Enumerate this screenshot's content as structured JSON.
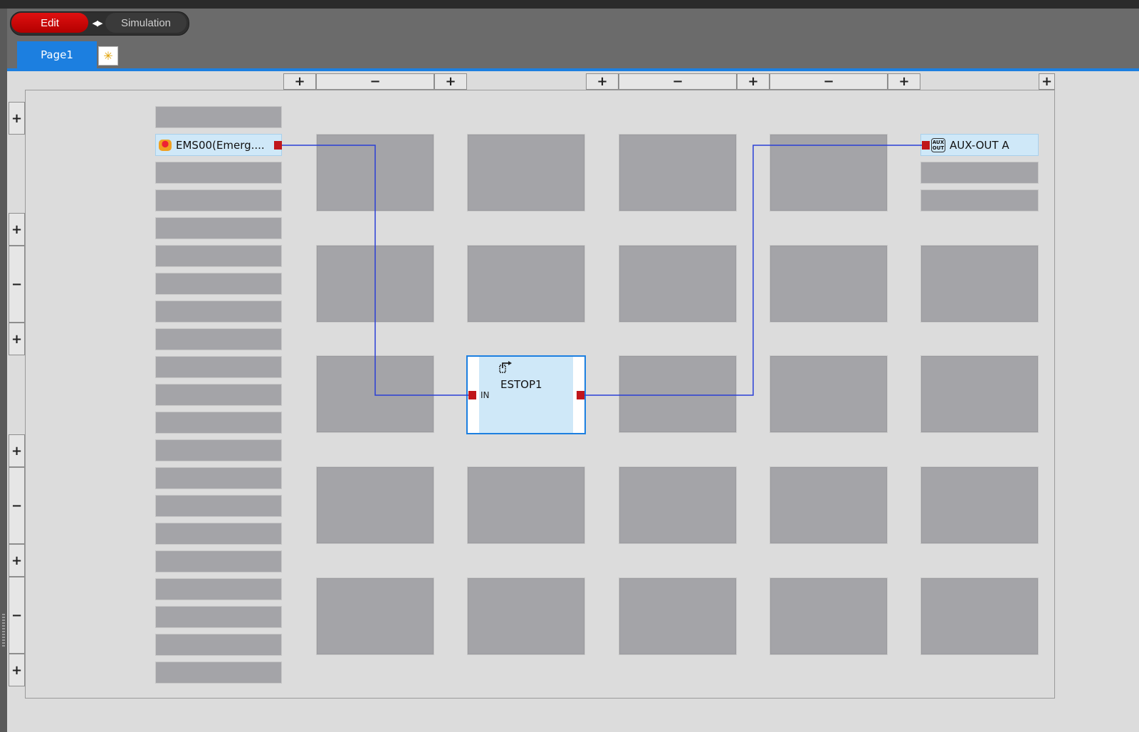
{
  "mode": {
    "edit_label": "Edit",
    "simulation_label": "Simulation",
    "active": "Edit",
    "active_color": "#d40000"
  },
  "tabs": [
    {
      "label": "Page1",
      "active": true
    }
  ],
  "controls": {
    "plus": "+",
    "minus": "−"
  },
  "inputs": {
    "rows": 21,
    "items": [
      {
        "row": 1,
        "label": "EMS00(Emerg...."
      }
    ]
  },
  "outputs": {
    "rows": 3,
    "items": [
      {
        "row": 0,
        "label": "AUX-OUT A"
      }
    ]
  },
  "function_block": {
    "name": "ESTOP1",
    "input_label": "IN"
  },
  "colors": {
    "accent": "#1c7fe0",
    "wire": "#2a3fd6",
    "port": "#c0161b",
    "selected_bg": "#cfe8f8"
  }
}
